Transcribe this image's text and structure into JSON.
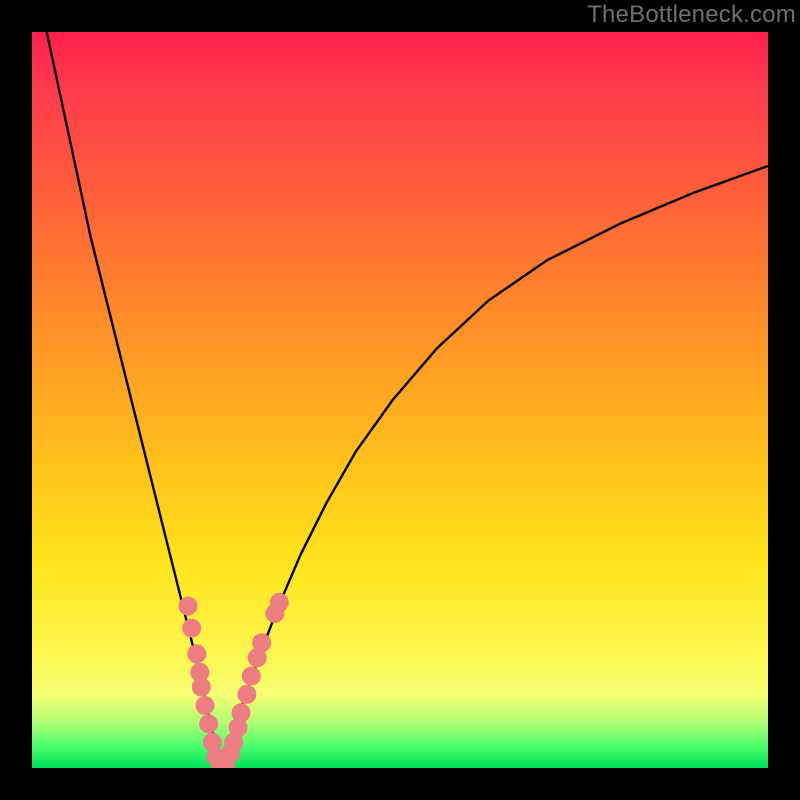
{
  "watermark": "TheBottleneck.com",
  "colors": {
    "frame": "#000000",
    "curve": "#000000",
    "marker_fill": "#ee7d82",
    "marker_stroke": "#ee7d82"
  },
  "chart_data": {
    "type": "line",
    "title": "",
    "xlabel": "",
    "ylabel": "",
    "xlim": [
      0,
      100
    ],
    "ylim": [
      0,
      100
    ],
    "grid": false,
    "legend": false,
    "series": [
      {
        "name": "left-branch",
        "x": [
          2,
          5,
          8,
          11,
          14,
          16,
          18,
          19.5,
          21,
          22.5,
          23.6,
          24.5,
          25.2,
          25.8
        ],
        "y": [
          100,
          86,
          72,
          60,
          48,
          40,
          32,
          26,
          20,
          14,
          9,
          5,
          2,
          0
        ]
      },
      {
        "name": "right-branch",
        "x": [
          25.8,
          26.5,
          27.5,
          29,
          31,
          33.5,
          36.5,
          40,
          44,
          49,
          55,
          62,
          70,
          80,
          90,
          100
        ],
        "y": [
          0,
          2,
          5,
          10,
          15.5,
          22,
          29,
          36,
          43,
          50,
          57,
          63.5,
          69,
          74,
          78.2,
          81.8
        ]
      }
    ],
    "markers": [
      {
        "x": 21.2,
        "y": 22.0
      },
      {
        "x": 21.7,
        "y": 19.0
      },
      {
        "x": 22.4,
        "y": 15.5
      },
      {
        "x": 22.8,
        "y": 13.0
      },
      {
        "x": 23.0,
        "y": 11.0
      },
      {
        "x": 23.5,
        "y": 8.5
      },
      {
        "x": 24.0,
        "y": 6.0
      },
      {
        "x": 24.5,
        "y": 3.5
      },
      {
        "x": 25.0,
        "y": 1.5
      },
      {
        "x": 25.6,
        "y": 0.5
      },
      {
        "x": 26.3,
        "y": 0.5
      },
      {
        "x": 27.0,
        "y": 2.0
      },
      {
        "x": 27.4,
        "y": 3.5
      },
      {
        "x": 28.0,
        "y": 5.5
      },
      {
        "x": 28.4,
        "y": 7.5
      },
      {
        "x": 29.2,
        "y": 10.0
      },
      {
        "x": 29.8,
        "y": 12.5
      },
      {
        "x": 30.6,
        "y": 15.0
      },
      {
        "x": 31.2,
        "y": 17.0
      },
      {
        "x": 33.0,
        "y": 21.0
      },
      {
        "x": 33.6,
        "y": 22.5
      }
    ],
    "marker_radius_px": 9
  }
}
